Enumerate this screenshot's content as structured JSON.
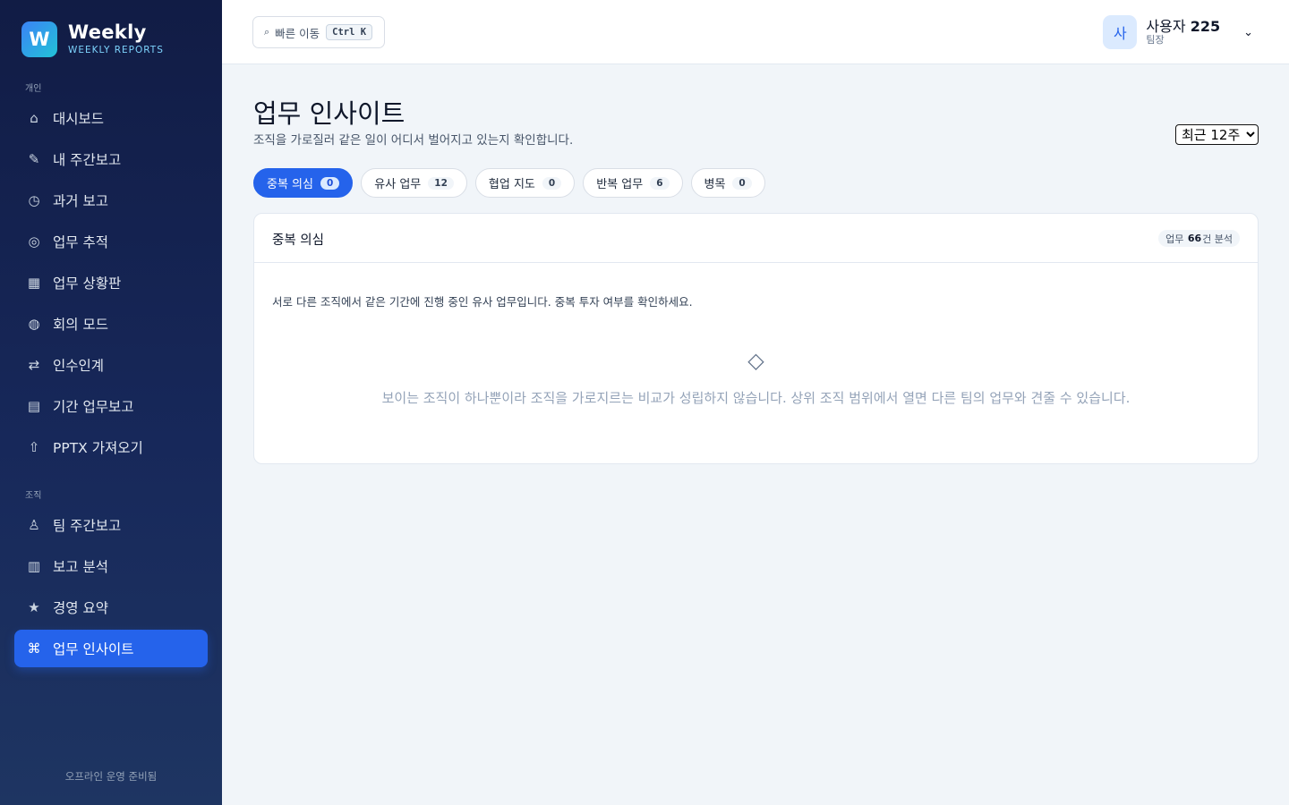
{
  "brand": {
    "logo_letter": "W",
    "name": "Weekly",
    "subtitle": "WEEKLY REPORTS"
  },
  "sidebar": {
    "personal_label": "개인",
    "personal_items": [
      {
        "icon": "home-icon",
        "glyph": "⌂",
        "label": "대시보드"
      },
      {
        "icon": "pencil-icon",
        "glyph": "✎",
        "label": "내 주간보고"
      },
      {
        "icon": "clock-icon",
        "glyph": "◷",
        "label": "과거 보고"
      },
      {
        "icon": "target-icon",
        "glyph": "◎",
        "label": "업무 추적"
      },
      {
        "icon": "grid-icon",
        "glyph": "▦",
        "label": "업무 상황판"
      },
      {
        "icon": "globe-icon",
        "glyph": "◍",
        "label": "회의 모드"
      },
      {
        "icon": "swap-icon",
        "glyph": "⇄",
        "label": "인수인계"
      },
      {
        "icon": "list-icon",
        "glyph": "▤",
        "label": "기간 업무보고"
      },
      {
        "icon": "upload-icon",
        "glyph": "⇧",
        "label": "PPTX 가져오기"
      }
    ],
    "org_label": "조직",
    "org_items": [
      {
        "icon": "team-icon",
        "glyph": "♙",
        "label": "팀 주간보고"
      },
      {
        "icon": "bars-icon",
        "glyph": "▥",
        "label": "보고 분석"
      },
      {
        "icon": "star-icon",
        "glyph": "★",
        "label": "경영 요약"
      },
      {
        "icon": "command-icon",
        "glyph": "⌘",
        "label": "업무 인사이트",
        "active": true
      }
    ],
    "footer": "오프라인 운영 준비됨"
  },
  "topbar": {
    "quick_glyph": "⌕",
    "quick_label": "빠른 이동",
    "quick_shortcut": "Ctrl K",
    "user_avatar": "사",
    "user_name_prefix": "사용자",
    "user_name_number": "225",
    "user_role": "팀장",
    "dropdown_glyph": "⌄"
  },
  "page": {
    "title": "업무 인사이트",
    "subtitle": "조직을 가로질러 같은 일이 어디서 벌어지고 있는지 확인합니다.",
    "range_options": [
      "최근 12주"
    ],
    "range_selected": "최근 12주"
  },
  "tabs": [
    {
      "label": "중복 의심",
      "count": "0",
      "active": true
    },
    {
      "label": "유사 업무",
      "count": "12"
    },
    {
      "label": "협업 지도",
      "count": "0"
    },
    {
      "label": "반복 업무",
      "count": "6"
    },
    {
      "label": "병목",
      "count": "0"
    }
  ],
  "panel": {
    "title": "중복 의심",
    "badge_prefix": "업무",
    "badge_number": "66",
    "badge_suffix": "건 분석",
    "description": "서로 다른 조직에서 같은 기간에 진행 중인 유사 업무입니다. 중복 투자 여부를 확인하세요.",
    "empty_glyph": "◇",
    "empty_text": "보이는 조직이 하나뿐이라 조직을 가로지르는 비교가 성립하지 않습니다. 상위 조직 범위에서 열면 다른 팀의 업무와 견줄 수 있습니다."
  }
}
